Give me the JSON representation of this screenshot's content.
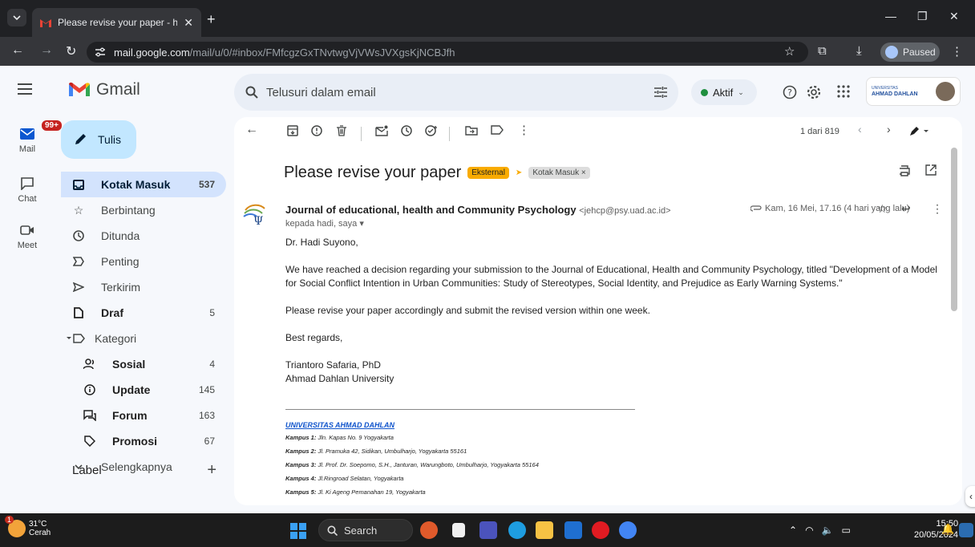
{
  "browser": {
    "tab_title": "Please revise your paper - hadi.",
    "url_host": "mail.google.com",
    "url_path": "/mail/u/0/#inbox/FMfcgzGxTNvtwgVjVWsJVXgsKjNCBJfh",
    "profile_status": "Paused"
  },
  "gmail": {
    "logo_text": "Gmail",
    "search_placeholder": "Telusuri dalam email",
    "status_label": "Aktif",
    "org_logo": {
      "line1": "UNIVERSITAS",
      "line2": "AHMAD DAHLAN"
    }
  },
  "rail": {
    "mail_label": "Mail",
    "mail_badge": "99+",
    "chat_label": "Chat",
    "meet_label": "Meet"
  },
  "nav": {
    "compose_label": "Tulis",
    "items": [
      {
        "label": "Kotak Masuk",
        "count": "537",
        "icon": "inbox-icon"
      },
      {
        "label": "Berbintang",
        "count": "",
        "icon": "star-icon"
      },
      {
        "label": "Ditunda",
        "count": "",
        "icon": "clock-icon"
      },
      {
        "label": "Penting",
        "count": "",
        "icon": "important-icon"
      },
      {
        "label": "Terkirim",
        "count": "",
        "icon": "send-icon"
      },
      {
        "label": "Draf",
        "count": "5",
        "icon": "draft-icon"
      },
      {
        "label": "Kategori",
        "count": "",
        "icon": "label-icon"
      },
      {
        "label": "Sosial",
        "count": "4",
        "icon": "people-icon"
      },
      {
        "label": "Update",
        "count": "145",
        "icon": "info-icon"
      },
      {
        "label": "Forum",
        "count": "163",
        "icon": "forum-icon"
      },
      {
        "label": "Promosi",
        "count": "67",
        "icon": "tag-icon"
      },
      {
        "label": "Selengkapnya",
        "count": "",
        "icon": "chevron-down-icon"
      }
    ],
    "labels_heading": "Label"
  },
  "message": {
    "pager": "1 dari 819",
    "subject": "Please revise your paper",
    "chip_external": "Eksternal",
    "chip_inbox": "Kotak Masuk ×",
    "sender_name": "Journal of educational, health and Community Psychology",
    "sender_email": "<jehcp@psy.uad.ac.id>",
    "to_line": "kepada hadi, saya ▾",
    "date": "Kam, 16 Mei, 17.16 (4 hari yang lalu)",
    "greeting": "Dr. Hadi Suyono,",
    "para1": "We have reached a decision regarding your submission to the Journal of Educational, Health and Community Psychology, titled \"Development of a Model for Social Conflict Intention in Urban Communities: Study of Stereotypes, Social Identity, and Prejudice as Early Warning Systems.\"",
    "para2": "Please revise your paper accordingly and submit the revised version within one week.",
    "closing": "Best regards,",
    "signer_name": "Triantoro Safaria, PhD",
    "signer_org": "Ahmad Dahlan University",
    "sig_uni": "UNIVERSITAS AHMAD DAHLAN",
    "campuses": [
      {
        "label": "Kampus 1:",
        "addr": "Jln. Kapas No. 9 Yogyakarta"
      },
      {
        "label": "Kampus 2:",
        "addr": "Jl. Pramuka 42, Sidikan, Umbulharjo, Yogyakarta 55161"
      },
      {
        "label": "Kampus 3:",
        "addr": "Jl. Prof. Dr. Soepomo, S.H., Janturan, Warungboto, Umbulharjo, Yogyakarta 55164"
      },
      {
        "label": "Kampus 4:",
        "addr": "Jl.Ringroad Selatan, Yogyakarta"
      },
      {
        "label": "Kampus 5:",
        "addr": "Jl. Ki Ageng Pemanahan 19, Yogyakarta"
      }
    ]
  },
  "taskbar": {
    "weather_temp": "31°C",
    "weather_desc": "Cerah",
    "weather_badge": "1",
    "search_label": "Search",
    "time": "15:50",
    "date": "20/05/2024"
  },
  "colors": {
    "accent_blue": "#0b57d0",
    "compose_bg": "#c2e7ff",
    "active_nav": "#d3e3fd",
    "external_chip": "#f9ab00"
  }
}
